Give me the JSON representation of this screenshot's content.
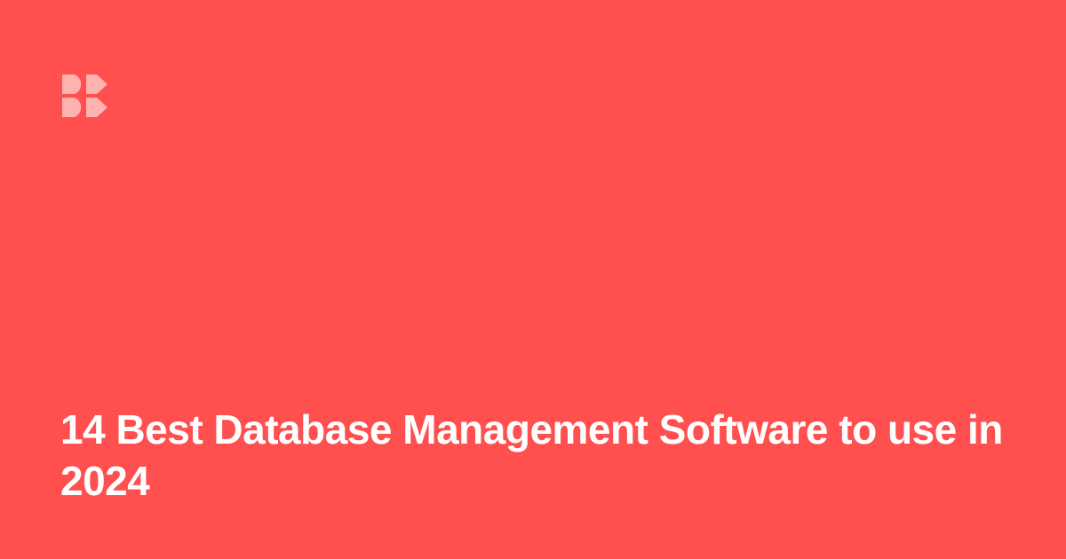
{
  "colors": {
    "background": "#FF4F4F",
    "logo": "#FFB3B0",
    "headline": "#FFFFFF"
  },
  "logo": {
    "icon": "brand-logo-icon"
  },
  "headline": {
    "text": "14 Best Database Management Software to use in 2024"
  }
}
